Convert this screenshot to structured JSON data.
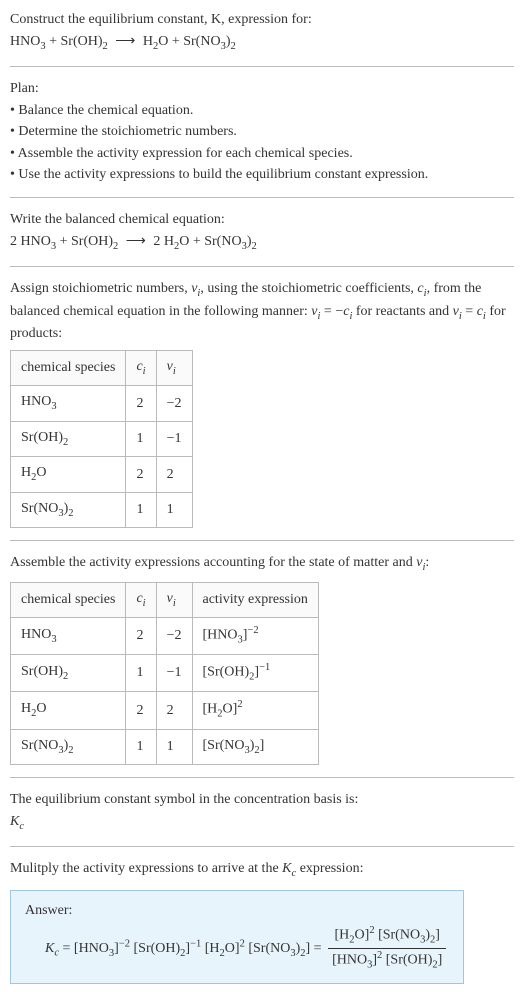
{
  "intro": {
    "line1": "Construct the equilibrium constant, K, expression for:",
    "eq_lhs1": "HNO",
    "eq_lhs1_sub": "3",
    "plus1": " + ",
    "eq_lhs2": "Sr(OH)",
    "eq_lhs2_sub": "2",
    "arrow": "⟶",
    "eq_rhs1": "H",
    "eq_rhs1_sub": "2",
    "eq_rhs1b": "O",
    "plus2": " + ",
    "eq_rhs2": "Sr(NO",
    "eq_rhs2_sub": "3",
    "eq_rhs2b": ")",
    "eq_rhs2_sub2": "2"
  },
  "plan": {
    "title": "Plan:",
    "b1": "• Balance the chemical equation.",
    "b2": "• Determine the stoichiometric numbers.",
    "b3": "• Assemble the activity expression for each chemical species.",
    "b4": "• Use the activity expressions to build the equilibrium constant expression."
  },
  "balanced": {
    "title": "Write the balanced chemical equation:",
    "c1": "2 HNO",
    "c1s": "3",
    "plus1": " + ",
    "c2": "Sr(OH)",
    "c2s": "2",
    "arrow": "⟶",
    "c3": "2 H",
    "c3s": "2",
    "c3b": "O",
    "plus2": " + ",
    "c4": "Sr(NO",
    "c4s": "3",
    "c4b": ")",
    "c4s2": "2"
  },
  "assign": {
    "p1a": "Assign stoichiometric numbers, ",
    "nu": "ν",
    "nu_sub": "i",
    "p1b": ", using the stoichiometric coefficients, ",
    "ci": "c",
    "ci_sub": "i",
    "p1c": ", from the balanced chemical equation in the following manner: ",
    "eq1a": "ν",
    "eq1a_sub": "i",
    "eq1b": " = −",
    "eq1c": "c",
    "eq1c_sub": "i",
    "p1d": " for reactants and ",
    "eq2a": "ν",
    "eq2a_sub": "i",
    "eq2b": " = ",
    "eq2c": "c",
    "eq2c_sub": "i",
    "p1e": " for products:"
  },
  "t1": {
    "h1": "chemical species",
    "h2_a": "c",
    "h2_sub": "i",
    "h3_a": "ν",
    "h3_sub": "i",
    "r1c1a": "HNO",
    "r1c1s": "3",
    "r1c2": "2",
    "r1c3": "−2",
    "r2c1a": "Sr(OH)",
    "r2c1s": "2",
    "r2c2": "1",
    "r2c3": "−1",
    "r3c1a": "H",
    "r3c1s": "2",
    "r3c1b": "O",
    "r3c2": "2",
    "r3c3": "2",
    "r4c1a": "Sr(NO",
    "r4c1s": "3",
    "r4c1b": ")",
    "r4c1s2": "2",
    "r4c2": "1",
    "r4c3": "1"
  },
  "assemble": {
    "p_a": "Assemble the activity expressions accounting for the state of matter and ",
    "nu": "ν",
    "nu_sub": "i",
    "p_b": ":"
  },
  "t2": {
    "h1": "chemical species",
    "h2_a": "c",
    "h2_sub": "i",
    "h3_a": "ν",
    "h3_sub": "i",
    "h4": "activity expression",
    "r1c1a": "HNO",
    "r1c1s": "3",
    "r1c2": "2",
    "r1c3": "−2",
    "r1c4a": "[HNO",
    "r1c4s": "3",
    "r1c4b": "]",
    "r1c4sup": "−2",
    "r2c1a": "Sr(OH)",
    "r2c1s": "2",
    "r2c2": "1",
    "r2c3": "−1",
    "r2c4a": "[Sr(OH)",
    "r2c4s": "2",
    "r2c4b": "]",
    "r2c4sup": "−1",
    "r3c1a": "H",
    "r3c1s": "2",
    "r3c1b": "O",
    "r3c2": "2",
    "r3c3": "2",
    "r3c4a": "[H",
    "r3c4s": "2",
    "r3c4b": "O]",
    "r3c4sup": "2",
    "r4c1a": "Sr(NO",
    "r4c1s": "3",
    "r4c1b": ")",
    "r4c1s2": "2",
    "r4c2": "1",
    "r4c3": "1",
    "r4c4a": "[Sr(NO",
    "r4c4s": "3",
    "r4c4b": ")",
    "r4c4s2": "2",
    "r4c4c": "]"
  },
  "symbol": {
    "p": "The equilibrium constant symbol in the concentration basis is:",
    "Kc_a": "K",
    "Kc_sub": "c"
  },
  "mult": {
    "p_a": "Mulitply the activity expressions to arrive at the ",
    "Kc_a": "K",
    "Kc_sub": "c",
    "p_b": " expression:"
  },
  "answer": {
    "label": "Answer:",
    "Kc_a": "K",
    "Kc_sub": "c",
    "eq": " = ",
    "t1a": "[HNO",
    "t1s": "3",
    "t1b": "]",
    "t1sup": "−2",
    "sp1": " ",
    "t2a": "[Sr(OH)",
    "t2s": "2",
    "t2b": "]",
    "t2sup": "−1",
    "sp2": " ",
    "t3a": "[H",
    "t3s": "2",
    "t3b": "O]",
    "t3sup": "2",
    "sp3": " ",
    "t4a": "[Sr(NO",
    "t4s": "3",
    "t4b": ")",
    "t4s2": "2",
    "t4c": "]",
    "eq2": " = ",
    "num1a": "[H",
    "num1s": "2",
    "num1b": "O]",
    "num1sup": "2",
    "numsp": " ",
    "num2a": "[Sr(NO",
    "num2s": "3",
    "num2b": ")",
    "num2s2": "2",
    "num2c": "]",
    "den1a": "[HNO",
    "den1s": "3",
    "den1b": "]",
    "den1sup": "2",
    "densp": " ",
    "den2a": "[Sr(OH)",
    "den2s": "2",
    "den2b": "]"
  }
}
